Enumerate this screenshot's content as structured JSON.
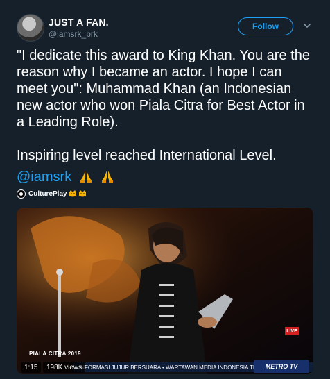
{
  "tweet": {
    "display_name": "JUST A FAN.",
    "handle": "@iamsrk_brk",
    "follow_label": "Follow",
    "text": "\"I dedicate this award to King Khan. You are the reason why I became an actor. I hope I can meet you\": Muhammad Khan (an Indonesian new actor who won Piala Citra for Best Actor in a Leading Role).\n\nInspiring level reached International Level.",
    "mention": "@iamsrk",
    "source_name": "CulturePlay"
  },
  "media": {
    "brand_label": "PIALA CITRA 2019",
    "duration": "1:15",
    "views": "198K views",
    "ticker": "INFORMASI JUJUR BERSUARA • WARTAWAN MEDIA INDONESIA TIDAK",
    "channel": "METRO TV",
    "live": "LIVE"
  },
  "icons": {
    "menu": "chevron-down-icon",
    "pray": "folded-hands-emoji",
    "cat": "cat-emoji"
  },
  "colors": {
    "background": "#15202b",
    "accent": "#1da1f2",
    "muted": "#8899a6"
  }
}
